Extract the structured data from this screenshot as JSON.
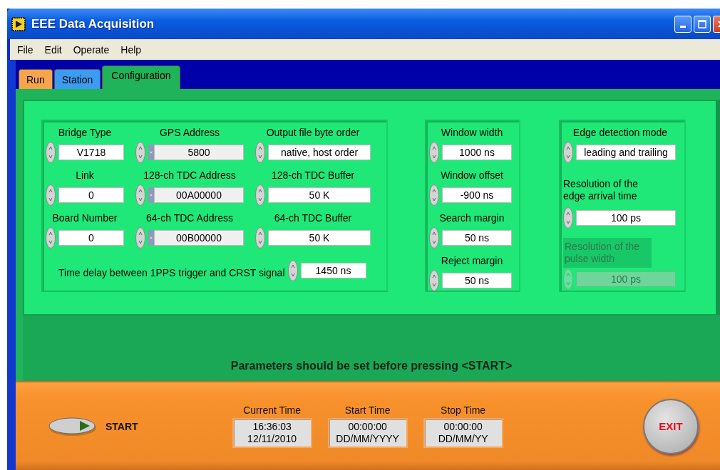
{
  "window": {
    "title": "EEE Data Acquisition"
  },
  "menu": [
    {
      "label": "File"
    },
    {
      "label": "Edit"
    },
    {
      "label": "Operate"
    },
    {
      "label": "Help"
    }
  ],
  "tabs": [
    {
      "label": "Run",
      "color": "#f7a54a",
      "selected": false
    },
    {
      "label": "Station",
      "color": "#3c9cf0",
      "selected": false
    },
    {
      "label": "Configuration",
      "color": "#1fb35a",
      "selected": true
    }
  ],
  "bridge_group": {
    "columns": [
      [
        {
          "label": "Bridge Type",
          "value": "V1718",
          "kind": "plain",
          "disabled": false
        },
        {
          "label": "Link",
          "value": "0",
          "kind": "plain",
          "disabled": false
        },
        {
          "label": "Board Number",
          "value": "0",
          "kind": "plain",
          "disabled": false
        }
      ],
      [
        {
          "label": "GPS Address",
          "value": "5800",
          "kind": "hex",
          "disabled": false
        },
        {
          "label": "128-ch TDC Address",
          "value": "00A00000",
          "kind": "hex",
          "disabled": false
        },
        {
          "label": "64-ch TDC Address",
          "value": "00B00000",
          "kind": "hex",
          "disabled": false
        }
      ],
      [
        {
          "label": "Output file byte order",
          "value": "native, host order",
          "kind": "plain",
          "disabled": false
        },
        {
          "label": "128-ch TDC Buffer",
          "value": "50 K",
          "kind": "plain",
          "disabled": false
        },
        {
          "label": "64-ch TDC Buffer",
          "value": "50 K",
          "kind": "plain",
          "disabled": false
        }
      ]
    ],
    "delay": {
      "label": "Time delay between 1PPS trigger and CRST signal",
      "value": "1450 ns",
      "disabled": false
    }
  },
  "window_group": [
    {
      "label": "Window width",
      "value": "1000 ns",
      "disabled": false
    },
    {
      "label": "Window offset",
      "value": "-900 ns",
      "disabled": false
    },
    {
      "label": "Search margin",
      "value": "50 ns",
      "disabled": false
    },
    {
      "label": "Reject margin",
      "value": "50 ns",
      "disabled": false
    }
  ],
  "edge_group": [
    {
      "label": "Edge detection mode",
      "value": "leading and trailing",
      "disabled": false
    },
    {
      "label": "Resolution of the edge arrival time",
      "value": "100 ps",
      "disabled": false
    },
    {
      "label": "Resolution of the pulse width",
      "value": "100 ps",
      "disabled": true
    }
  ],
  "message": "Parameters should be set before pressing <START>",
  "start_button": {
    "label": "START"
  },
  "times": [
    {
      "label": "Current Time",
      "time": "16:36:03",
      "date": "12/11/2010"
    },
    {
      "label": "Start Time",
      "time": "00:00:00",
      "date": "DD/MM/YYYY"
    },
    {
      "label": "Stop Time",
      "time": "00:00:00",
      "date": "DD/MM/YY"
    }
  ],
  "exit_button": {
    "label": "EXIT"
  }
}
